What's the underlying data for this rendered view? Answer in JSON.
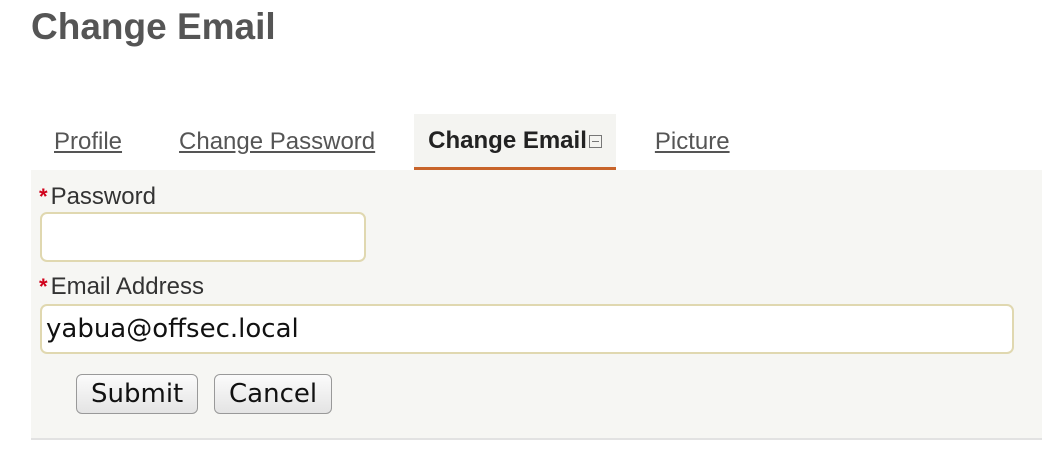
{
  "page": {
    "title": "Change Email"
  },
  "tabs": [
    {
      "label": "Profile",
      "active": false
    },
    {
      "label": "Change Password",
      "active": false
    },
    {
      "label": "Change Email",
      "active": true
    },
    {
      "label": "Picture",
      "active": false
    }
  ],
  "form": {
    "required_marker": "*",
    "password": {
      "label": "Password",
      "value": ""
    },
    "email": {
      "label": "Email Address",
      "value": "yabua@offsec.local"
    },
    "submit_label": "Submit",
    "cancel_label": "Cancel"
  },
  "colors": {
    "tab_active_underline": "#c8642a",
    "required_marker": "#d0021b",
    "input_border": "#e0d8b0"
  }
}
